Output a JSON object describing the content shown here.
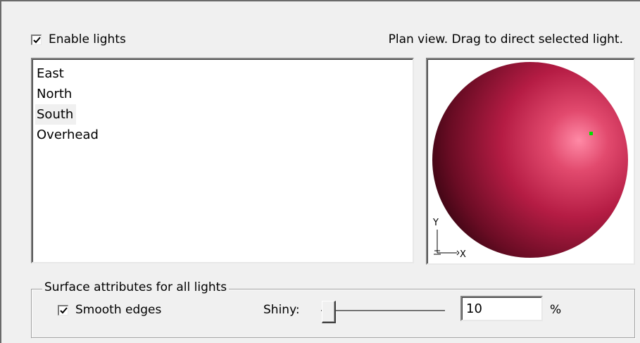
{
  "enable_lights": {
    "label": "Enable lights",
    "checked": true
  },
  "hint": "Plan view. Drag to direct selected light.",
  "lights": [
    {
      "label": "East",
      "selected": false
    },
    {
      "label": "North",
      "selected": false
    },
    {
      "label": "South",
      "selected": true
    },
    {
      "label": "Overhead",
      "selected": false
    }
  ],
  "plan_view": {
    "axis_y": "Y",
    "axis_x": "X",
    "sphere_color": "#c0204a",
    "light_marker_color": "#00e000"
  },
  "surface": {
    "title": "Surface attributes for all lights",
    "smooth_edges": {
      "label": "Smooth edges",
      "checked": true
    },
    "shiny_label": "Shiny:",
    "shiny_value": "10",
    "percent_sign": "%"
  }
}
